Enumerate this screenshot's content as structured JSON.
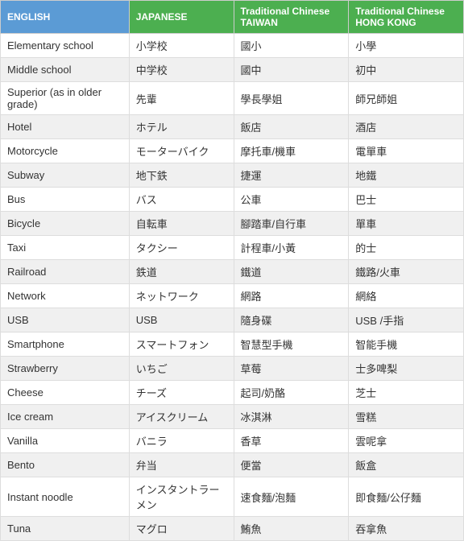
{
  "headers": {
    "english": "ENGLISH",
    "japanese": "JAPANESE",
    "tc_taiwan": "Traditional Chinese\nTAIWAN",
    "tc_hk": "Traditional Chinese\nHONG KONG"
  },
  "rows": [
    {
      "english": "Elementary school",
      "japanese": "小学校",
      "tc_taiwan": "國小",
      "tc_hk": "小學"
    },
    {
      "english": "Middle school",
      "japanese": "中学校",
      "tc_taiwan": "國中",
      "tc_hk": "初中"
    },
    {
      "english": "Superior (as in older grade)",
      "japanese": "先輩",
      "tc_taiwan": "學長學姐",
      "tc_hk": "師兄師姐"
    },
    {
      "english": "Hotel",
      "japanese": "ホテル",
      "tc_taiwan": "飯店",
      "tc_hk": "酒店"
    },
    {
      "english": "Motorcycle",
      "japanese": "モーターバイク",
      "tc_taiwan": "摩托車/機車",
      "tc_hk": "電單車"
    },
    {
      "english": "Subway",
      "japanese": "地下鉄",
      "tc_taiwan": "捷運",
      "tc_hk": "地鐵"
    },
    {
      "english": "Bus",
      "japanese": "バス",
      "tc_taiwan": "公車",
      "tc_hk": "巴士"
    },
    {
      "english": "Bicycle",
      "japanese": "自転車",
      "tc_taiwan": "腳踏車/自行車",
      "tc_hk": "單車"
    },
    {
      "english": "Taxi",
      "japanese": "タクシー",
      "tc_taiwan": "計程車/小黃",
      "tc_hk": "的士"
    },
    {
      "english": "Railroad",
      "japanese": "鉄道",
      "tc_taiwan": "鐵道",
      "tc_hk": "鐵路/火車"
    },
    {
      "english": "Network",
      "japanese": "ネットワーク",
      "tc_taiwan": "網路",
      "tc_hk": "網絡"
    },
    {
      "english": "USB",
      "japanese": "USB",
      "tc_taiwan": "隨身碟",
      "tc_hk": "USB /手指"
    },
    {
      "english": "Smartphone",
      "japanese": "スマートフォン",
      "tc_taiwan": "智慧型手機",
      "tc_hk": "智能手機"
    },
    {
      "english": "Strawberry",
      "japanese": "いちご",
      "tc_taiwan": "草莓",
      "tc_hk": "士多啤梨"
    },
    {
      "english": "Cheese",
      "japanese": "チーズ",
      "tc_taiwan": "起司/奶酪",
      "tc_hk": "芝士"
    },
    {
      "english": "Ice cream",
      "japanese": "アイスクリーム",
      "tc_taiwan": "冰淇淋",
      "tc_hk": "雪糕"
    },
    {
      "english": "Vanilla",
      "japanese": "バニラ",
      "tc_taiwan": "香草",
      "tc_hk": "雲呢拿"
    },
    {
      "english": "Bento",
      "japanese": "弁当",
      "tc_taiwan": "便當",
      "tc_hk": "飯盒"
    },
    {
      "english": "Instant noodle",
      "japanese": "インスタントラーメン",
      "tc_taiwan": "速食麵/泡麵",
      "tc_hk": "即食麵/公仔麵"
    },
    {
      "english": "Tuna",
      "japanese": "マグロ",
      "tc_taiwan": "鮪魚",
      "tc_hk": "吞拿魚"
    }
  ]
}
